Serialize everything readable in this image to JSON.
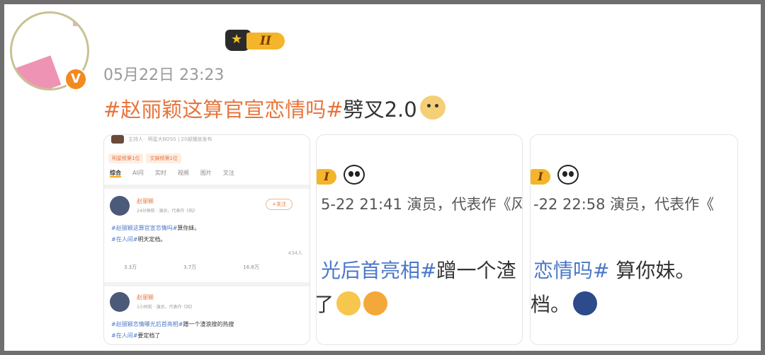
{
  "post": {
    "level_badge": "II",
    "timestamp": "05月22日 23:23",
    "hashtag": "#赵丽颖这算官宣恋情吗#",
    "text": "劈叉2.0",
    "verified_badge": "V"
  },
  "colors": {
    "accent": "#e8743b",
    "link": "#4a77c9",
    "badge": "#f5b52a"
  },
  "thumb1": {
    "top_meta": "主持人 · 明星大BOSS | 20部播放发布",
    "chips": [
      "明星榜第1位",
      "文娱榜第1位"
    ],
    "tabs": [
      "综合",
      "AI问",
      "实时",
      "视频",
      "图片",
      "文注"
    ],
    "posts": [
      {
        "name": "赵丽颖",
        "meta": "24分钟前 · 演员，代表作《风》",
        "follow": "+关注",
        "line1_tag": "#赵丽颖这算官宣恋情吗#",
        "line1_text": "算你妹。",
        "line2_tag": "#在人间#",
        "line2_text": "明天定档。",
        "views": "434人",
        "reposts": "3.3万",
        "comments": "3.7万",
        "likes": "16.8万"
      },
      {
        "name": "赵丽颖",
        "meta": "1小时前 · 演员，代表作《风》",
        "line1_tag": "#赵丽颖恋情曝光后首亮相#",
        "line1_text": "蹭一个渣浪搜的热搜",
        "line2_tag": "#在人间#",
        "line2_text": "要定档了"
      }
    ]
  },
  "thumb2": {
    "badge": "I",
    "meta": "5-22 21:41  演员，代表作《风",
    "post_tag": "光后首亮相#",
    "post_text": "蹭一个渣",
    "line2": "了"
  },
  "thumb3": {
    "badge": "I",
    "meta": "-22 22:58  演员，代表作《",
    "post_tag": "恋情吗#",
    "post_text": " 算你妹。",
    "line2": "档。"
  }
}
